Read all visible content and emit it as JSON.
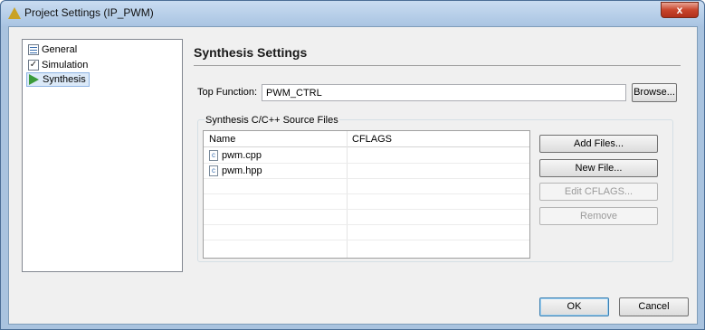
{
  "window": {
    "title": "Project Settings (IP_PWM)",
    "close_glyph": "x"
  },
  "tree": {
    "items": [
      {
        "label": "General",
        "icon": "general-settings-icon"
      },
      {
        "label": "Simulation",
        "icon": "checkbox-icon"
      },
      {
        "label": "Synthesis",
        "icon": "play-icon",
        "selected": true
      }
    ]
  },
  "main": {
    "heading": "Synthesis Settings",
    "top_function_label": "Top Function:",
    "top_function_value": "PWM_CTRL",
    "browse_label": "Browse...",
    "group_label": "Synthesis C/C++ Source Files",
    "columns": [
      "Name",
      "CFLAGS"
    ],
    "files": [
      {
        "name": "pwm.cpp",
        "cflags": ""
      },
      {
        "name": "pwm.hpp",
        "cflags": ""
      }
    ],
    "buttons": {
      "add_files": "Add Files...",
      "new_file": "New File...",
      "edit_cflags": "Edit CFLAGS...",
      "remove": "Remove"
    }
  },
  "footer": {
    "ok": "OK",
    "cancel": "Cancel"
  },
  "colors": {
    "titlebar": "#a9c4e2",
    "close": "#c8452c",
    "selection": "#dbe9f8",
    "play_icon": "#3a9b3a"
  }
}
